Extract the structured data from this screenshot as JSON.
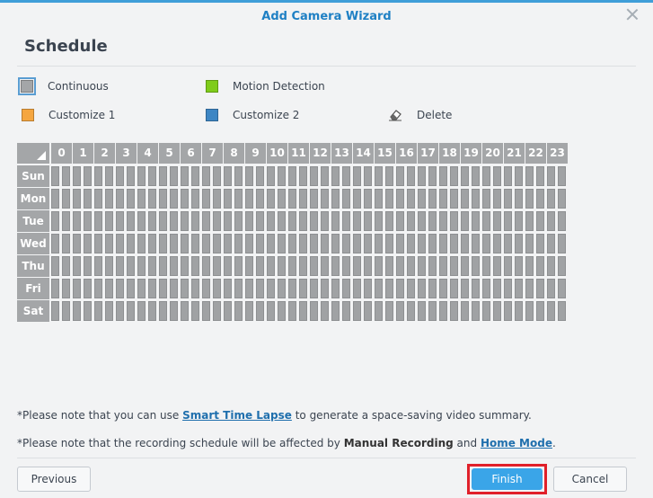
{
  "dialog": {
    "title": "Add Camera Wizard",
    "step_title": "Schedule"
  },
  "legend": {
    "continuous": {
      "label": "Continuous",
      "color": "#a4a6a8"
    },
    "motion": {
      "label": "Motion Detection",
      "color": "#7fcc1a"
    },
    "custom1": {
      "label": "Customize 1",
      "color": "#f5a640"
    },
    "custom2": {
      "label": "Customize 2",
      "color": "#3e86c4"
    },
    "delete": {
      "label": "Delete",
      "icon": "eraser-icon"
    }
  },
  "schedule": {
    "hours": [
      "0",
      "1",
      "2",
      "3",
      "4",
      "5",
      "6",
      "7",
      "8",
      "9",
      "10",
      "11",
      "12",
      "13",
      "14",
      "15",
      "16",
      "17",
      "18",
      "19",
      "20",
      "21",
      "22",
      "23"
    ],
    "days": [
      "Sun",
      "Mon",
      "Tue",
      "Wed",
      "Thu",
      "Fri",
      "Sat"
    ],
    "fill_mode": "Continuous"
  },
  "notes": {
    "note1_prefix": "*Please note that you can use ",
    "note1_link": "Smart Time Lapse",
    "note1_suffix": " to generate a space-saving video summary.",
    "note2_prefix": "*Please note that the recording schedule will be affected by ",
    "note2_bold": "Manual Recording",
    "note2_and": " and ",
    "note2_link": "Home Mode",
    "note2_suffix": "."
  },
  "footer": {
    "previous": "Previous",
    "finish": "Finish",
    "cancel": "Cancel"
  }
}
